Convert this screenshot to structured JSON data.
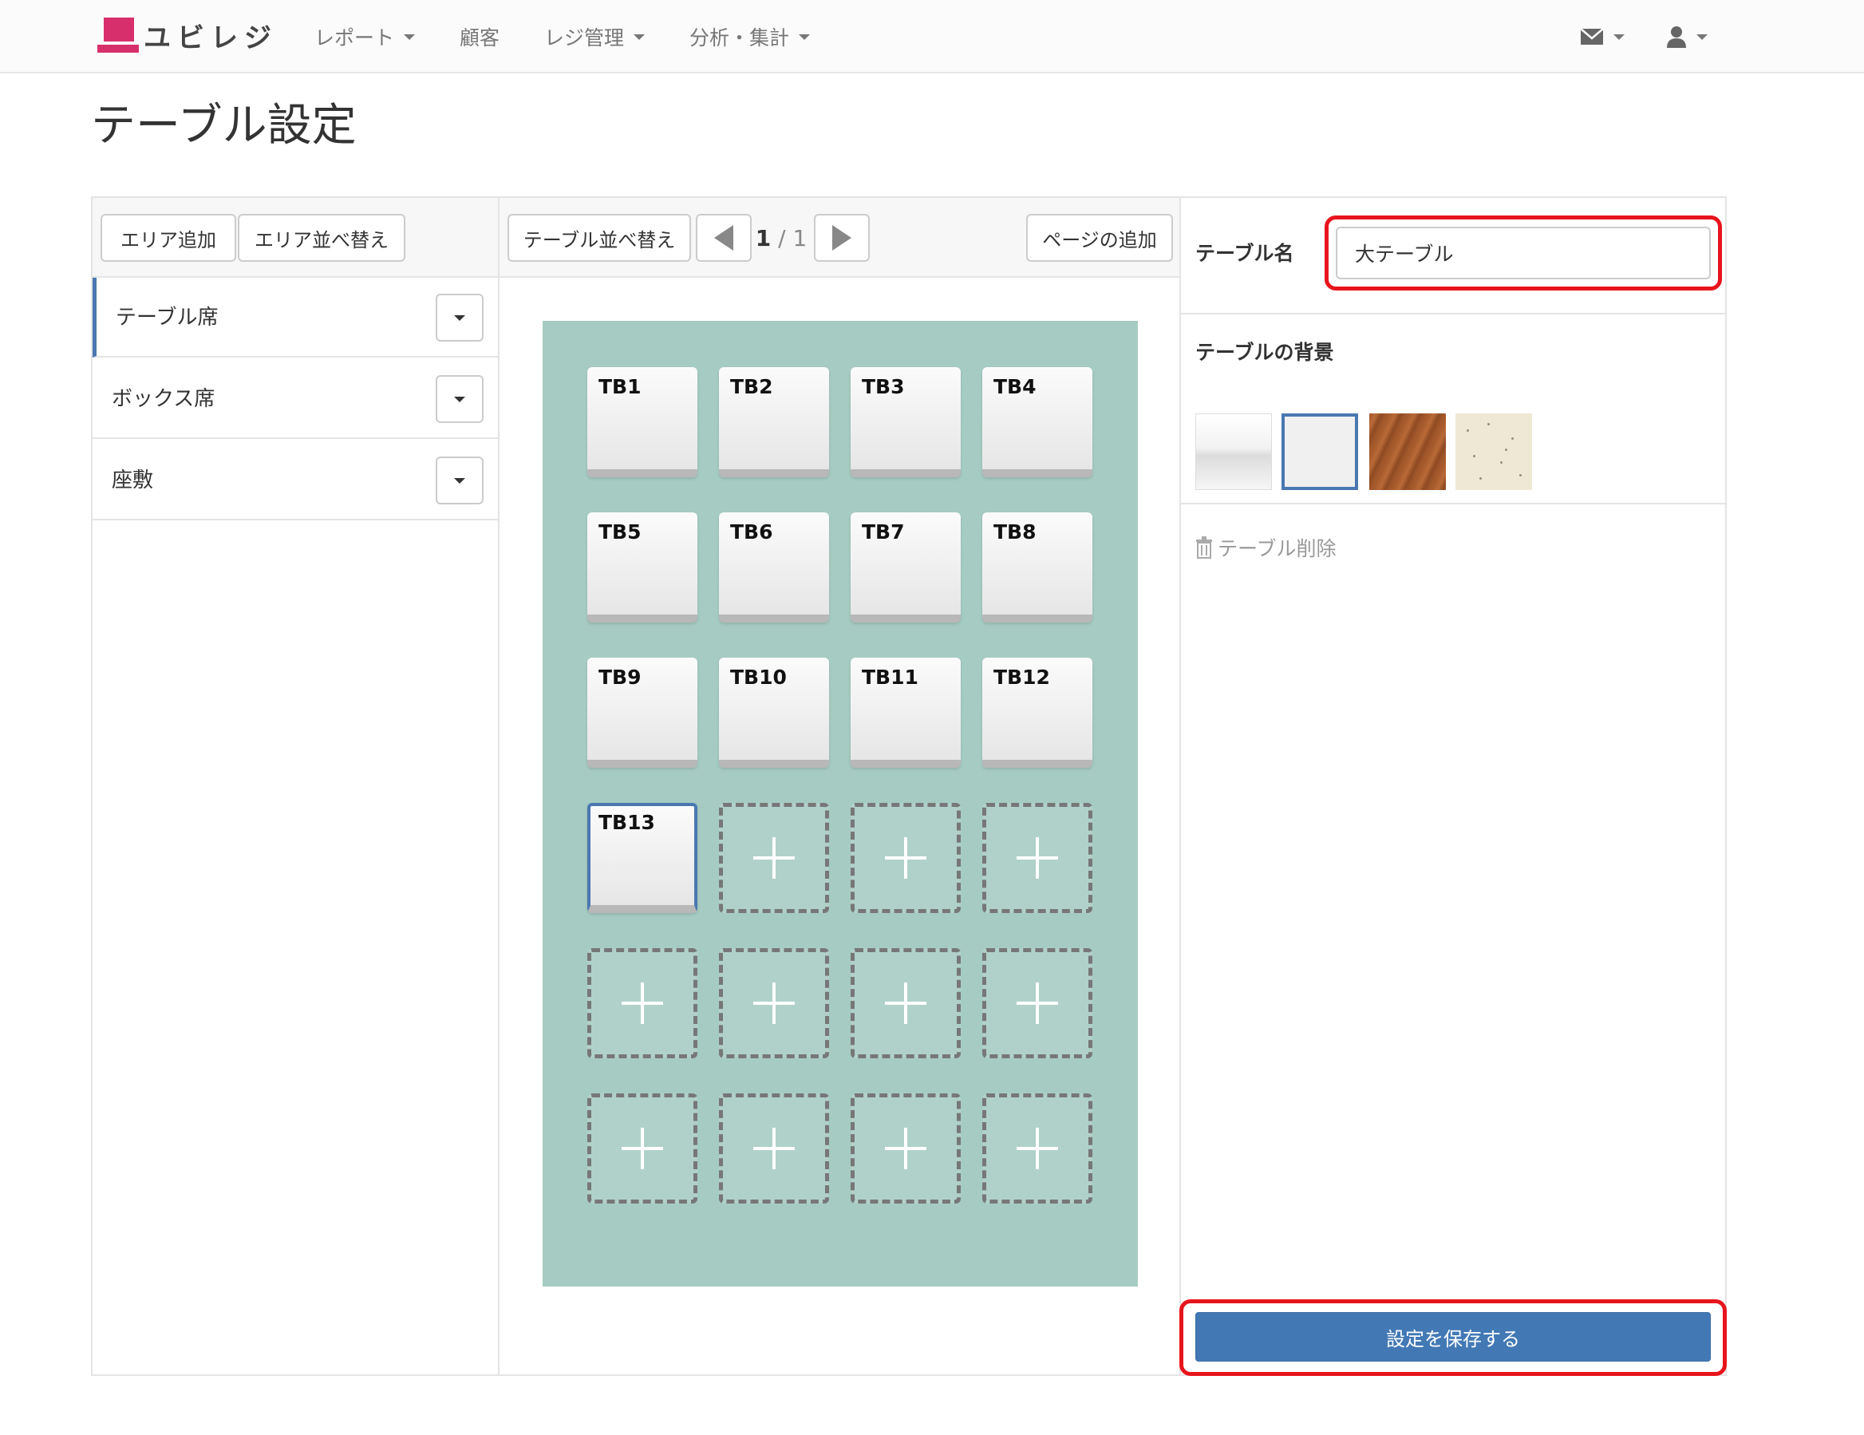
{
  "navbar": {
    "brand": "ユビレジ",
    "menu": [
      {
        "label": "レポート",
        "dropdown": true
      },
      {
        "label": "顧客",
        "dropdown": false
      },
      {
        "label": "レジ管理",
        "dropdown": true
      },
      {
        "label": "分析・集計",
        "dropdown": true
      }
    ],
    "icons": [
      "mail-icon",
      "user-icon"
    ]
  },
  "page": {
    "title": "テーブル設定"
  },
  "areas": {
    "add_label": "エリア追加",
    "sort_label": "エリア並べ替え",
    "items": [
      {
        "label": "テーブル席",
        "active": true
      },
      {
        "label": "ボックス席",
        "active": false
      },
      {
        "label": "座敷",
        "active": false
      }
    ]
  },
  "layout": {
    "sort_tables_label": "テーブル並べ替え",
    "add_page_label": "ページの追加",
    "page_current": "1",
    "page_separator": " / ",
    "page_total": "1",
    "tables": [
      "TB1",
      "TB2",
      "TB3",
      "TB4",
      "TB5",
      "TB6",
      "TB7",
      "TB8",
      "TB9",
      "TB10",
      "TB11",
      "TB12",
      "TB13"
    ],
    "selected_table": "TB13",
    "columns": 4,
    "rows": 6,
    "floor_color": "#a6cbc2"
  },
  "detail": {
    "name_label": "テーブル名",
    "name_value": "大テーブル",
    "background_label": "テーブルの背景",
    "background_options": [
      "white-glossy",
      "light-gray",
      "wood",
      "speckled-cream"
    ],
    "selected_background": "light-gray",
    "delete_label": "テーブル削除",
    "save_label": "設定を保存する"
  },
  "colors": {
    "accent": "#4279b5",
    "brand": "#d72f6b",
    "highlight": "#e8141c"
  }
}
